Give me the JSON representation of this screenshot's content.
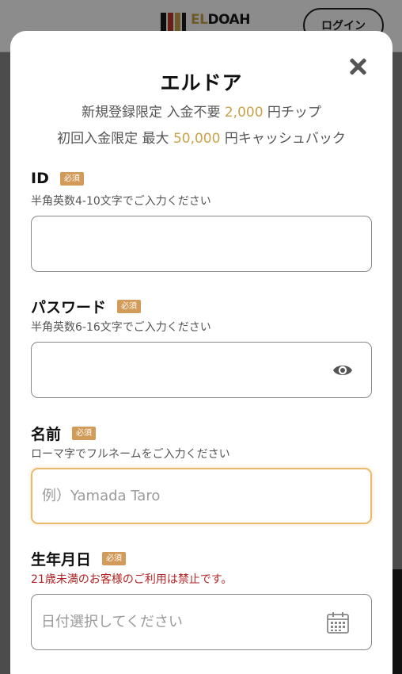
{
  "header": {
    "logo_text_accent": "EL",
    "logo_text_rest": "DOAH",
    "login_button": "ログイン"
  },
  "modal": {
    "title": "エルドア",
    "promo1": {
      "prefix": "新規登録限定 入金不要 ",
      "amount": "2,000",
      "suffix": " 円チップ"
    },
    "promo2": {
      "prefix": "初回入金限定 最大 ",
      "amount": "50,000",
      "suffix": " 円キャッシュバック"
    },
    "required_badge": "必須",
    "fields": {
      "id": {
        "label": "ID",
        "hint": "半角英数4-10文字でご入力ください",
        "value": "",
        "placeholder": ""
      },
      "password": {
        "label": "パスワード",
        "hint": "半角英数6-16文字でご入力ください",
        "value": "",
        "placeholder": ""
      },
      "name": {
        "label": "名前",
        "hint": "ローマ字でフルネームをご入力ください",
        "value": "",
        "placeholder": "例）Yamada Taro"
      },
      "birthdate": {
        "label": "生年月日",
        "hint": "21歳未満のお客様のご利用は禁止です。",
        "value": "",
        "placeholder": "日付選択してください"
      }
    }
  },
  "colors": {
    "accent_gold": "#c9a24a",
    "required_badge": "#d39b5a",
    "warning_text": "#b22222",
    "focus_border": "#e9b96e"
  },
  "icons": {
    "close": "close-icon",
    "password_toggle": "eye-icon",
    "date_picker": "calendar-icon"
  }
}
